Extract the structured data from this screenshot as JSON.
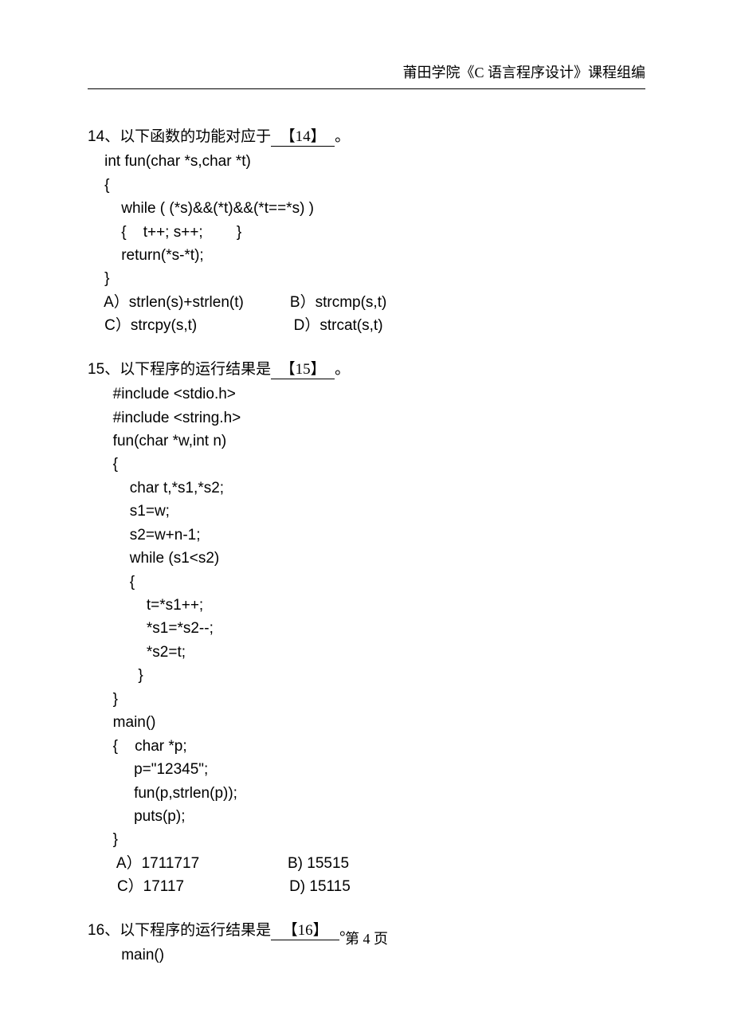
{
  "header": "莆田学院《C 语言程序设计》课程组编",
  "q14": {
    "num": "14、",
    "stem_pre": "以下函数的功能对应于",
    "blank": "【14】",
    "stem_post": "。",
    "code": "    int fun(char *s,char *t)\n    {\n        while ( (*s)&&(*t)&&(*t==*s) )\n        {    t++; s++;        }\n        return(*s-*t);\n    }",
    "opts": "    A）strlen(s)+strlen(t)           B）strcmp(s,t)\n    C）strcpy(s,t)                       D）strcat(s,t)"
  },
  "q15": {
    "num": "15、",
    "stem_pre": "以下程序的运行结果是",
    "blank": "【15】",
    "stem_post": "。",
    "code": "      #include <stdio.h>\n      #include <string.h>\n      fun(char *w,int n)\n      {\n          char t,*s1,*s2;\n          s1=w;\n          s2=w+n-1;\n          while (s1<s2)\n          {\n              t=*s1++;\n              *s1=*s2--;\n              *s2=t;\n            }\n      }\n      main()\n      {    char *p;\n           p=\"12345\";\n           fun(p,strlen(p));\n           puts(p);\n      }",
    "opts": "       A）1711717                     B) 15515\n       C）17117                         D) 15115"
  },
  "q16": {
    "num": "16、",
    "stem_pre": "以下程序的运行结果是",
    "blank": "【16】",
    "stem_post": "。",
    "code": "        main()"
  },
  "footer": "第 4 页"
}
